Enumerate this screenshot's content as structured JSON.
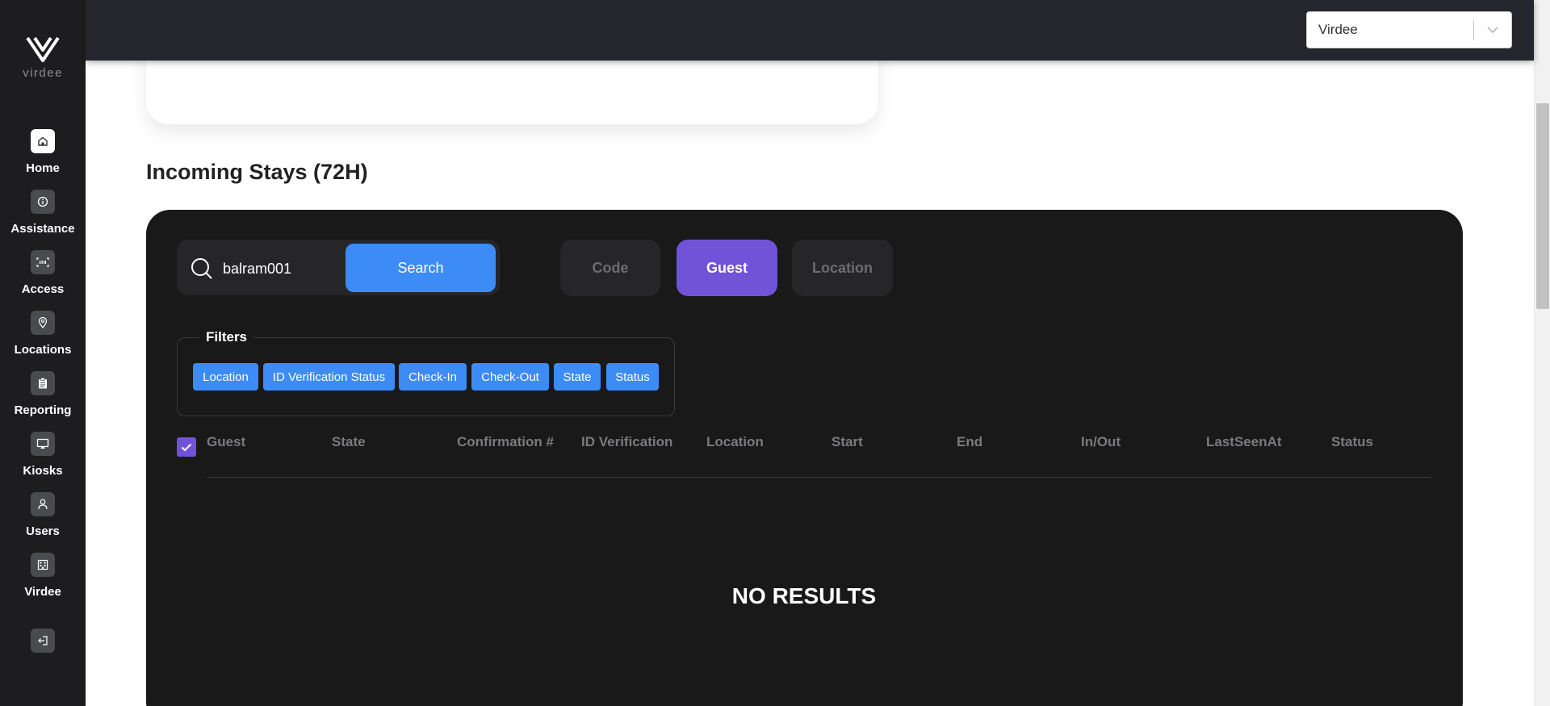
{
  "brand": {
    "name": "virdee"
  },
  "nav": [
    {
      "label": "Home",
      "icon": "home-icon"
    },
    {
      "label": "Assistance",
      "icon": "info-icon"
    },
    {
      "label": "Access",
      "icon": "access-icon"
    },
    {
      "label": "Locations",
      "icon": "location-pin-icon"
    },
    {
      "label": "Reporting",
      "icon": "clipboard-icon"
    },
    {
      "label": "Kiosks",
      "icon": "kiosk-icon"
    },
    {
      "label": "Users",
      "icon": "user-icon"
    },
    {
      "label": "Virdee",
      "icon": "building-icon"
    }
  ],
  "logout": {
    "icon": "logout-icon"
  },
  "org_select": {
    "value": "Virdee"
  },
  "section": {
    "title": "Incoming Stays (72H)"
  },
  "search": {
    "value": "balram001",
    "button_label": "Search"
  },
  "modes": {
    "code": "Code",
    "guest": "Guest",
    "location": "Location"
  },
  "filters": {
    "title": "Filters",
    "chips": [
      "Location",
      "ID Verification Status",
      "Check-In",
      "Check-Out",
      "State",
      "Status"
    ]
  },
  "table": {
    "select_all_checked": true,
    "columns": [
      "Guest",
      "State",
      "Confirmation #",
      "ID Verification",
      "Location",
      "Start",
      "End",
      "In/Out",
      "LastSeenAt",
      "Status"
    ],
    "empty_message": "NO RESULTS"
  },
  "colors": {
    "accent_purple": "#7153d8",
    "accent_blue": "#3d8bf5",
    "sidebar_bg": "#1d1d1f",
    "topbar_bg": "#25262d",
    "panel_bg": "#19191a"
  }
}
